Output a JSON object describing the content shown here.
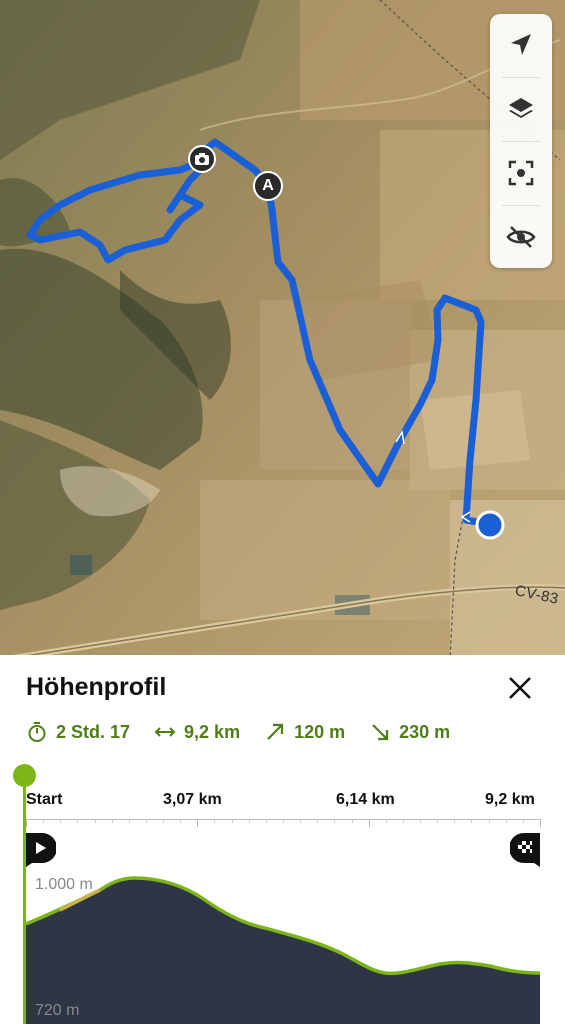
{
  "map": {
    "road_label": "CV-83",
    "waypoint_label": "A",
    "controls": [
      "navigate-icon",
      "layers-icon",
      "focus-icon",
      "hide-icon"
    ]
  },
  "sheet": {
    "title": "Höhenprofil",
    "stats": {
      "duration": "2 Std. 17",
      "distance": "9,2 km",
      "ascent": "120 m",
      "descent": "230 m"
    },
    "km_labels": [
      "Start",
      "3,07 km",
      "6,14 km",
      "9,2 km"
    ],
    "elevation_labels": {
      "top": "1.000 m",
      "bottom": "720 m"
    },
    "colors": {
      "accent": "#7cb518",
      "route": "#1a5fd6",
      "profile_fill": "#2e3545",
      "stats": "#4f7e16"
    }
  }
}
